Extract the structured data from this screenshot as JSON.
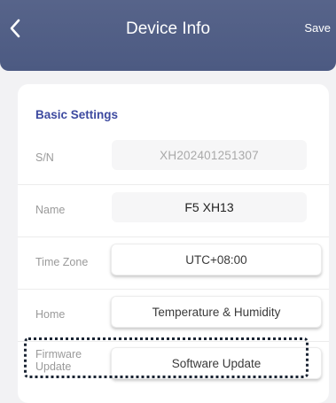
{
  "header": {
    "title": "Device Info",
    "save_label": "Save",
    "back_icon": "chevron-left-icon",
    "background_color": "#52608a"
  },
  "basic_settings": {
    "title": "Basic Settings",
    "title_color": "#3d4aa0",
    "rows": [
      {
        "label": "S/N",
        "value": "XH202401251307"
      },
      {
        "label": "Name",
        "value": "F5 XH13"
      },
      {
        "label": "Time Zone",
        "value": "UTC+08:00"
      },
      {
        "label": "Home",
        "value": "Temperature & Humidity"
      },
      {
        "label": "Firmware\nUpdate",
        "value": "Software Update"
      }
    ]
  }
}
